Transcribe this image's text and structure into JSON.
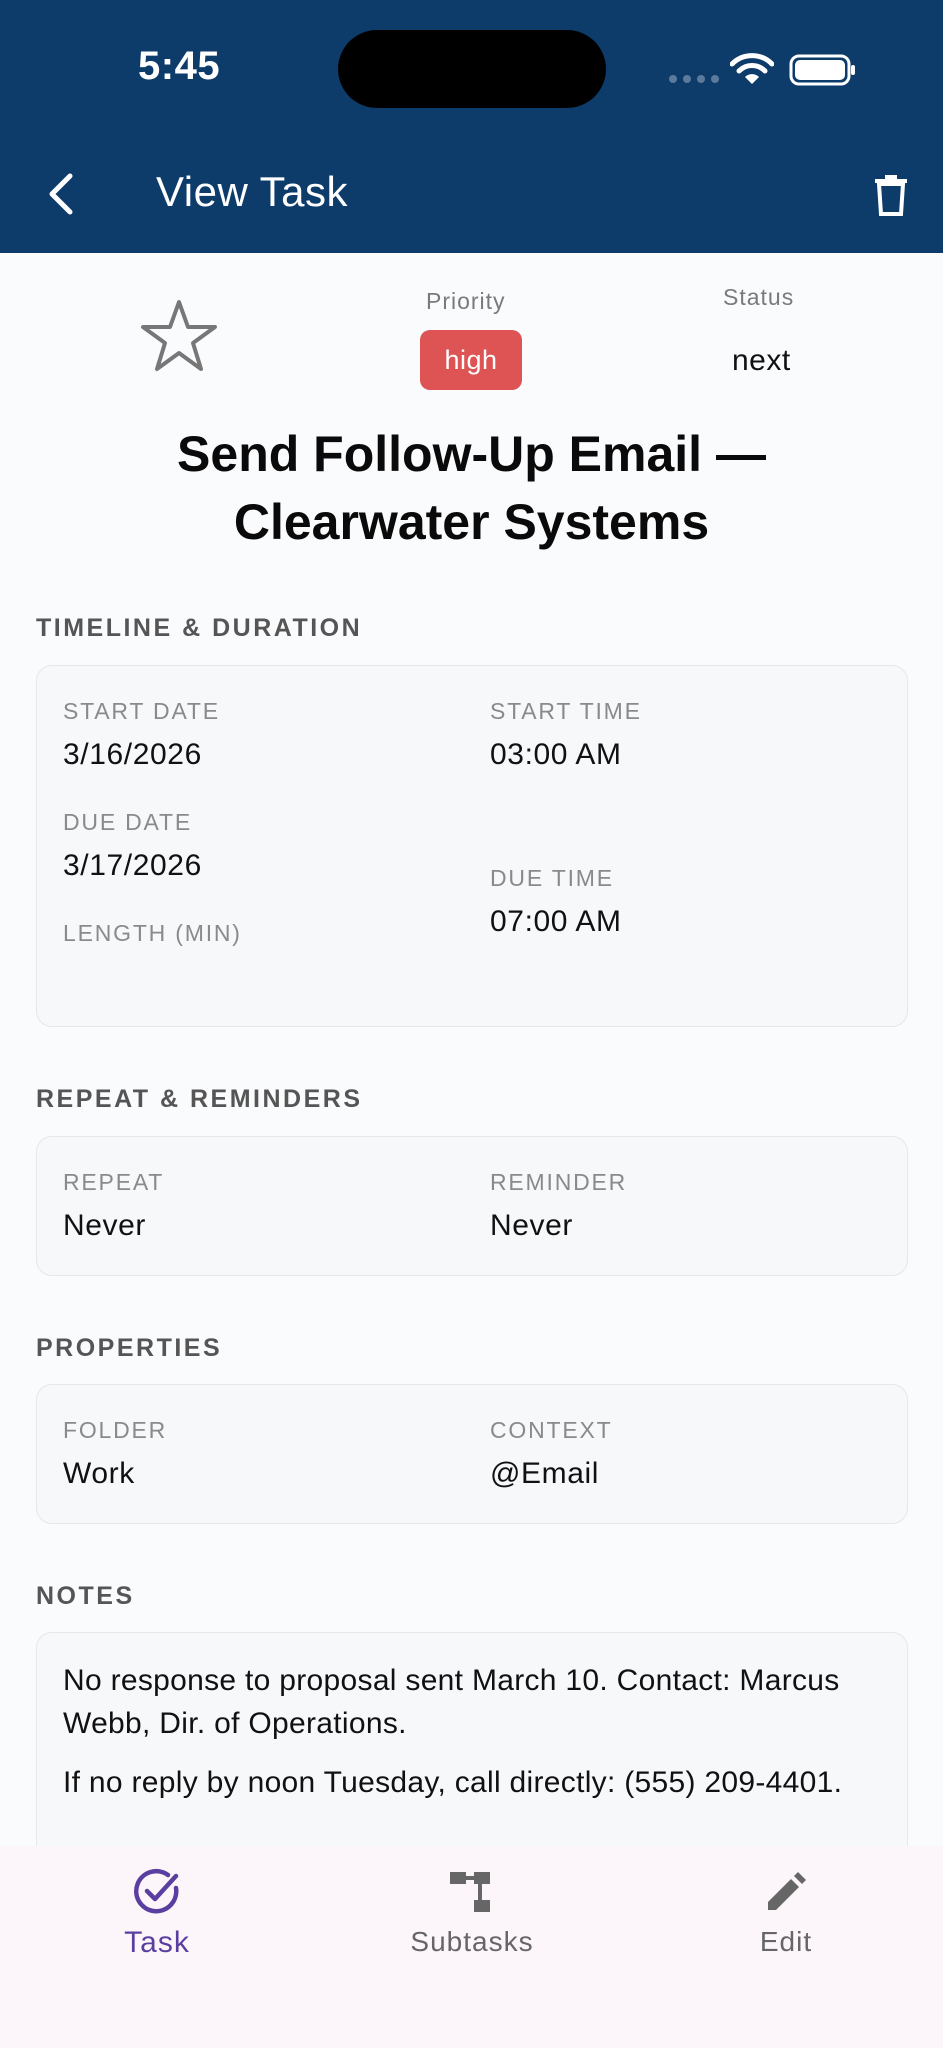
{
  "status_bar": {
    "time": "5:45"
  },
  "nav": {
    "title": "View Task"
  },
  "header": {
    "priority_label": "Priority",
    "priority_value": "high",
    "status_label": "Status",
    "status_value": "next",
    "title": "Send Follow-Up Email — Clearwater Systems"
  },
  "timeline": {
    "heading": "TIMELINE & DURATION",
    "start_date_label": "START DATE",
    "start_date": "3/16/2026",
    "start_time_label": "START TIME",
    "start_time": "03:00 AM",
    "due_date_label": "DUE DATE",
    "due_date": "3/17/2026",
    "due_time_label": "DUE TIME",
    "due_time": "07:00 AM",
    "length_label": "LENGTH (MIN)"
  },
  "repeat": {
    "heading": "REPEAT & REMINDERS",
    "repeat_label": "REPEAT",
    "repeat_value": "Never",
    "reminder_label": "REMINDER",
    "reminder_value": "Never"
  },
  "properties": {
    "heading": "PROPERTIES",
    "folder_label": "FOLDER",
    "folder_value": "Work",
    "context_label": "CONTEXT",
    "context_value": "@Email"
  },
  "notes": {
    "heading": "NOTES",
    "paragraphs": [
      "No response to proposal sent March 10. Contact: Marcus Webb, Dir. of Operations.",
      "If no reply by noon Tuesday, call directly: (555) 209-4401."
    ]
  },
  "bottom_nav": {
    "tabs": [
      {
        "label": "Task",
        "icon": "check-circle-icon",
        "active": true
      },
      {
        "label": "Subtasks",
        "icon": "hierarchy-icon",
        "active": false
      },
      {
        "label": "Edit",
        "icon": "pencil-icon",
        "active": false
      }
    ]
  },
  "colors": {
    "header_bg": "#0d3c6b",
    "priority_high": "#de5454",
    "active_tab": "#5a3fa0",
    "page_bg": "#fafbfd"
  }
}
